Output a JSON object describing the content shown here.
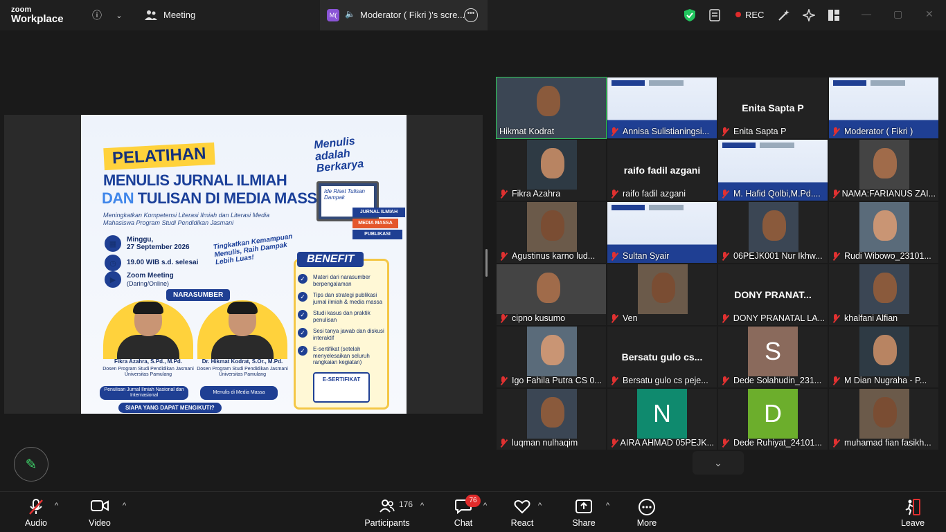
{
  "app": {
    "brand_line1": "zoom",
    "brand_line2": "Workplace",
    "meeting_label": "Meeting"
  },
  "share_tab": {
    "badge": "M(",
    "title": "Moderator ( Fikri )'s scre..."
  },
  "status": {
    "rec_label": "REC"
  },
  "poster": {
    "badge": "PELATIHAN",
    "title_line1": "MENULIS JURNAL ILMIAH",
    "title_dan": "DAN",
    "title_line2": "TULISAN DI MEDIA MASSA",
    "subtitle": "Meningkatkan Kompetensi Literasi Ilmiah dan Literasi Media Mahasiswa Program Studi Pendidikan Jasmani",
    "slogan_top": "Menulis adalah Berkarya",
    "laptop_text": "Ide Riset Tulisan Dampak",
    "books": [
      "JURNAL ILMIAH",
      "MEDIA MASSA",
      "PUBLIKASI"
    ],
    "date_line1": "Minggu,",
    "date_line2": "27 September 2026",
    "time": "19.00 WIB s.d. selesai",
    "platform": "Zoom Meeting",
    "platform_sub": "(Daring/Online)",
    "tagline": "Tingkatkan Kemampuan Menulis, Raih Dampak Lebih Luas!",
    "benefit_title": "BENEFIT",
    "benefits": [
      "Materi dari narasumber berpengalaman",
      "Tips dan strategi publikasi jurnal ilmiah & media massa",
      "Studi kasus dan praktik penulisan",
      "Sesi tanya jawab dan diskusi interaktif",
      "E-sertifikat (setelah menyelesaikan seluruh rangkaian kegiatan)"
    ],
    "cert_label": "E-SERTIFIKAT",
    "narasumber_label": "NARASUMBER",
    "speakers": [
      {
        "name": "Fikra Azahra, S.Pd., M.Pd.",
        "role": "Dosen Program Studi Pendidikan Jasmani Universitas Pamulang",
        "topic": "Penulisan Jurnal Ilmiah Nasional dan Internasional"
      },
      {
        "name": "Dr. Hikmat Kodrat, S.Or., M.Pd.",
        "role": "Dosen Program Studi Pendidikan Jasmani Universitas Pamulang",
        "topic": "Menulis di Media Massa"
      }
    ],
    "footer": "SIAPA YANG DAPAT MENGIKUTI?"
  },
  "participants": [
    {
      "name": "Hikmat Kodrat",
      "type": "video",
      "active": true
    },
    {
      "name": "Annisa Sulistianingsi...",
      "type": "slide"
    },
    {
      "name": "Enita Sapta P",
      "type": "name",
      "big": "Enita Sapta P"
    },
    {
      "name": "Moderator ( Fikri )",
      "type": "slide"
    },
    {
      "name": "Fikra Azahra",
      "type": "video"
    },
    {
      "name": "raifo fadil azgani",
      "type": "name",
      "big": "raifo fadil azgani"
    },
    {
      "name": "M. Hafid Qolbi,M.Pd....",
      "type": "slide"
    },
    {
      "name": "NAMA:FARIANUS ZAI...",
      "type": "video"
    },
    {
      "name": "Agustinus karno lud...",
      "type": "video"
    },
    {
      "name": "Sultan Syair",
      "type": "slide"
    },
    {
      "name": "06PEJK001 Nur Ikhw...",
      "type": "video"
    },
    {
      "name": "Rudi Wibowo_23101...",
      "type": "video"
    },
    {
      "name": "cipno kusumo",
      "type": "video"
    },
    {
      "name": "Ven",
      "type": "video"
    },
    {
      "name": "DONY PRANATAL LA...",
      "type": "name",
      "big": "DONY PRANAT..."
    },
    {
      "name": "khalfani Alfian",
      "type": "video"
    },
    {
      "name": "Igo Fahila Putra CS 0...",
      "type": "video"
    },
    {
      "name": "Bersatu gulo cs peje...",
      "type": "name",
      "big": "Bersatu gulo cs..."
    },
    {
      "name": "Dede Solahudin_231...",
      "type": "avatar",
      "letter": "S",
      "color": "#8a6a5c"
    },
    {
      "name": "M Dian Nugraha - P...",
      "type": "video"
    },
    {
      "name": "luqman nulhaqim",
      "type": "video"
    },
    {
      "name": "AIRA AHMAD 05PEJK...",
      "type": "avatar",
      "letter": "N",
      "color": "#0f8a6e"
    },
    {
      "name": "Dede Ruhiyat_24101...",
      "type": "avatar",
      "letter": "D",
      "color": "#6cae2c"
    },
    {
      "name": "muhamad fian fasikh...",
      "type": "video"
    }
  ],
  "toolbar": {
    "audio": "Audio",
    "video": "Video",
    "participants": "Participants",
    "participants_count": "176",
    "chat": "Chat",
    "chat_badge": "76",
    "react": "React",
    "share": "Share",
    "more": "More",
    "leave": "Leave"
  },
  "colors": {
    "active_speaker": "#2fcf5a",
    "muted": "#e13131",
    "rec": "#e02b2b",
    "shield": "#22c55e"
  }
}
